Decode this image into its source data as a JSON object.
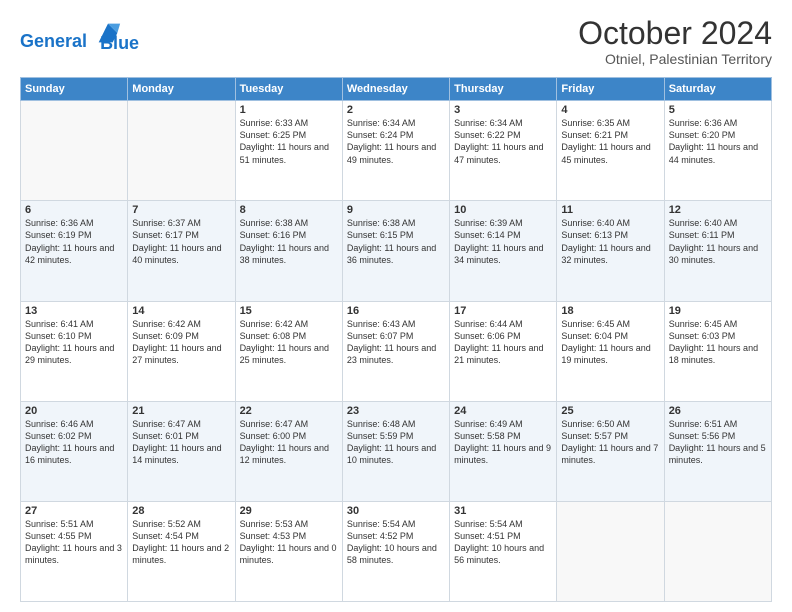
{
  "logo": {
    "line1": "General",
    "line2": "Blue"
  },
  "header": {
    "month": "October 2024",
    "location": "Otniel, Palestinian Territory"
  },
  "days_of_week": [
    "Sunday",
    "Monday",
    "Tuesday",
    "Wednesday",
    "Thursday",
    "Friday",
    "Saturday"
  ],
  "weeks": [
    [
      {
        "day": "",
        "info": ""
      },
      {
        "day": "",
        "info": ""
      },
      {
        "day": "1",
        "info": "Sunrise: 6:33 AM\nSunset: 6:25 PM\nDaylight: 11 hours and 51 minutes."
      },
      {
        "day": "2",
        "info": "Sunrise: 6:34 AM\nSunset: 6:24 PM\nDaylight: 11 hours and 49 minutes."
      },
      {
        "day": "3",
        "info": "Sunrise: 6:34 AM\nSunset: 6:22 PM\nDaylight: 11 hours and 47 minutes."
      },
      {
        "day": "4",
        "info": "Sunrise: 6:35 AM\nSunset: 6:21 PM\nDaylight: 11 hours and 45 minutes."
      },
      {
        "day": "5",
        "info": "Sunrise: 6:36 AM\nSunset: 6:20 PM\nDaylight: 11 hours and 44 minutes."
      }
    ],
    [
      {
        "day": "6",
        "info": "Sunrise: 6:36 AM\nSunset: 6:19 PM\nDaylight: 11 hours and 42 minutes."
      },
      {
        "day": "7",
        "info": "Sunrise: 6:37 AM\nSunset: 6:17 PM\nDaylight: 11 hours and 40 minutes."
      },
      {
        "day": "8",
        "info": "Sunrise: 6:38 AM\nSunset: 6:16 PM\nDaylight: 11 hours and 38 minutes."
      },
      {
        "day": "9",
        "info": "Sunrise: 6:38 AM\nSunset: 6:15 PM\nDaylight: 11 hours and 36 minutes."
      },
      {
        "day": "10",
        "info": "Sunrise: 6:39 AM\nSunset: 6:14 PM\nDaylight: 11 hours and 34 minutes."
      },
      {
        "day": "11",
        "info": "Sunrise: 6:40 AM\nSunset: 6:13 PM\nDaylight: 11 hours and 32 minutes."
      },
      {
        "day": "12",
        "info": "Sunrise: 6:40 AM\nSunset: 6:11 PM\nDaylight: 11 hours and 30 minutes."
      }
    ],
    [
      {
        "day": "13",
        "info": "Sunrise: 6:41 AM\nSunset: 6:10 PM\nDaylight: 11 hours and 29 minutes."
      },
      {
        "day": "14",
        "info": "Sunrise: 6:42 AM\nSunset: 6:09 PM\nDaylight: 11 hours and 27 minutes."
      },
      {
        "day": "15",
        "info": "Sunrise: 6:42 AM\nSunset: 6:08 PM\nDaylight: 11 hours and 25 minutes."
      },
      {
        "day": "16",
        "info": "Sunrise: 6:43 AM\nSunset: 6:07 PM\nDaylight: 11 hours and 23 minutes."
      },
      {
        "day": "17",
        "info": "Sunrise: 6:44 AM\nSunset: 6:06 PM\nDaylight: 11 hours and 21 minutes."
      },
      {
        "day": "18",
        "info": "Sunrise: 6:45 AM\nSunset: 6:04 PM\nDaylight: 11 hours and 19 minutes."
      },
      {
        "day": "19",
        "info": "Sunrise: 6:45 AM\nSunset: 6:03 PM\nDaylight: 11 hours and 18 minutes."
      }
    ],
    [
      {
        "day": "20",
        "info": "Sunrise: 6:46 AM\nSunset: 6:02 PM\nDaylight: 11 hours and 16 minutes."
      },
      {
        "day": "21",
        "info": "Sunrise: 6:47 AM\nSunset: 6:01 PM\nDaylight: 11 hours and 14 minutes."
      },
      {
        "day": "22",
        "info": "Sunrise: 6:47 AM\nSunset: 6:00 PM\nDaylight: 11 hours and 12 minutes."
      },
      {
        "day": "23",
        "info": "Sunrise: 6:48 AM\nSunset: 5:59 PM\nDaylight: 11 hours and 10 minutes."
      },
      {
        "day": "24",
        "info": "Sunrise: 6:49 AM\nSunset: 5:58 PM\nDaylight: 11 hours and 9 minutes."
      },
      {
        "day": "25",
        "info": "Sunrise: 6:50 AM\nSunset: 5:57 PM\nDaylight: 11 hours and 7 minutes."
      },
      {
        "day": "26",
        "info": "Sunrise: 6:51 AM\nSunset: 5:56 PM\nDaylight: 11 hours and 5 minutes."
      }
    ],
    [
      {
        "day": "27",
        "info": "Sunrise: 5:51 AM\nSunset: 4:55 PM\nDaylight: 11 hours and 3 minutes."
      },
      {
        "day": "28",
        "info": "Sunrise: 5:52 AM\nSunset: 4:54 PM\nDaylight: 11 hours and 2 minutes."
      },
      {
        "day": "29",
        "info": "Sunrise: 5:53 AM\nSunset: 4:53 PM\nDaylight: 11 hours and 0 minutes."
      },
      {
        "day": "30",
        "info": "Sunrise: 5:54 AM\nSunset: 4:52 PM\nDaylight: 10 hours and 58 minutes."
      },
      {
        "day": "31",
        "info": "Sunrise: 5:54 AM\nSunset: 4:51 PM\nDaylight: 10 hours and 56 minutes."
      },
      {
        "day": "",
        "info": ""
      },
      {
        "day": "",
        "info": ""
      }
    ]
  ]
}
